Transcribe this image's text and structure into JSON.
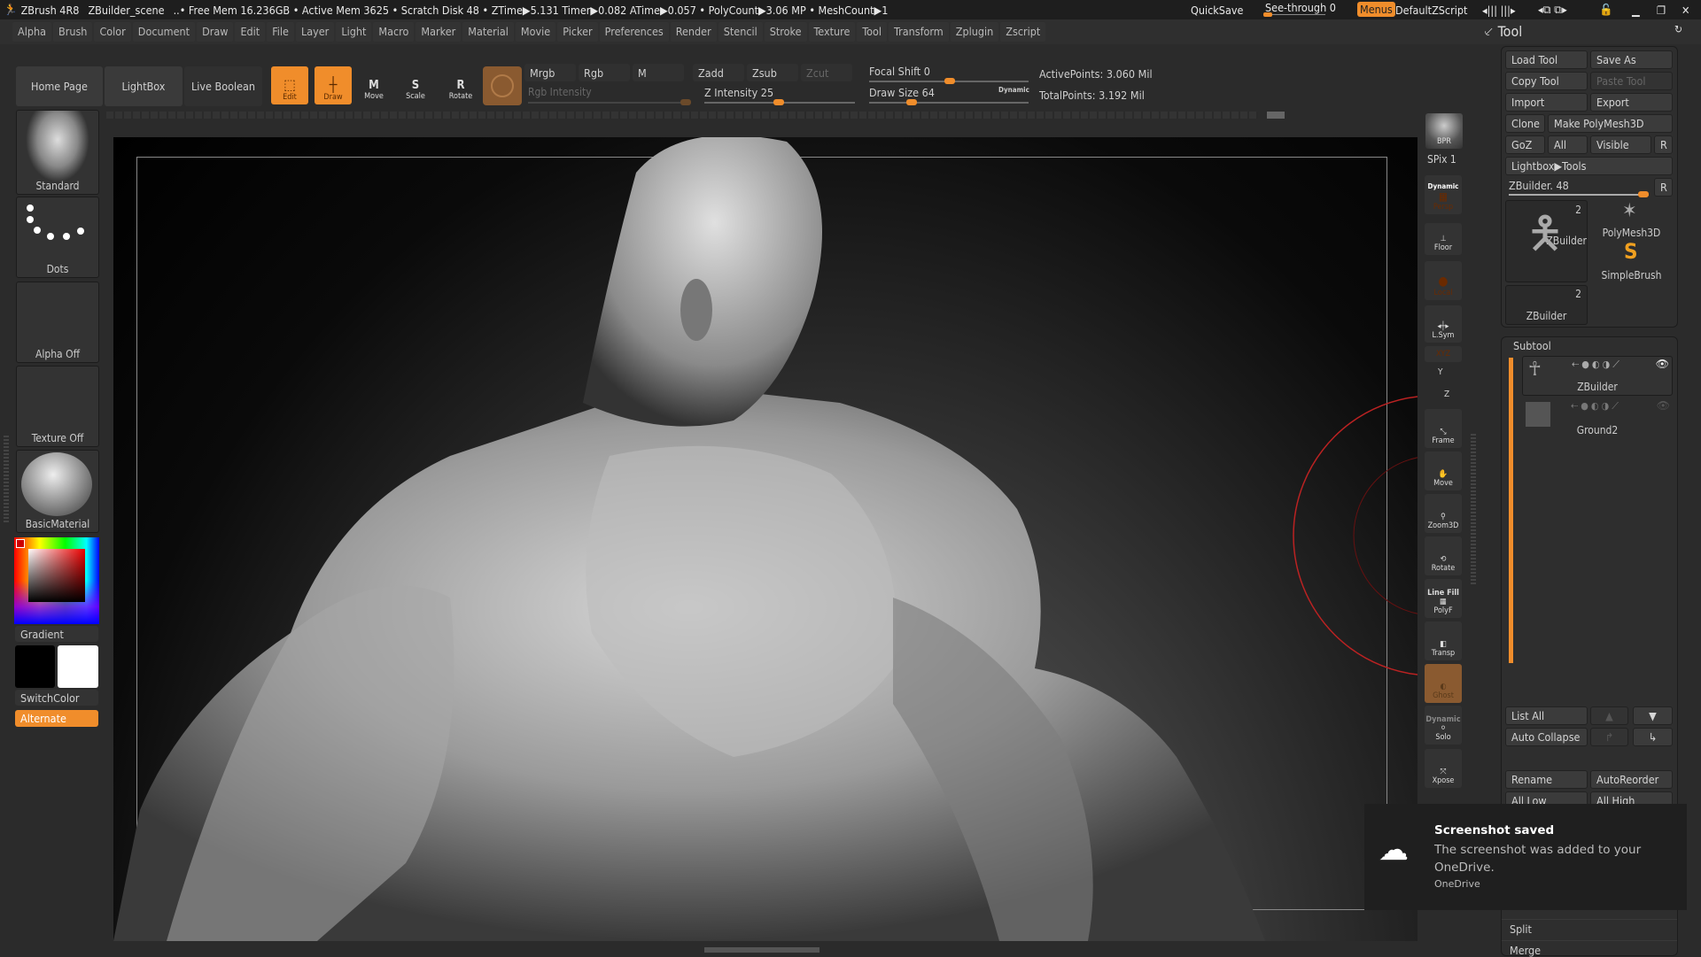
{
  "titlebar": {
    "app": "ZBrush 4R8",
    "scene": "ZBuilder_scene",
    "stats": "..• Free Mem 16.236GB • Active Mem 3625 • Scratch Disk 48 • ZTime▶5.131 Timer▶0.082 ATime▶0.057 • PolyCount▶3.06 MP • MeshCount▶1",
    "quicksave": "QuickSave",
    "seethrough": "See-through  0",
    "seethrough_value": 0,
    "menus": "Menus",
    "defaultzscript": "DefaultZScript"
  },
  "menus": [
    "Alpha",
    "Brush",
    "Color",
    "Document",
    "Draw",
    "Edit",
    "File",
    "Layer",
    "Light",
    "Macro",
    "Marker",
    "Material",
    "Movie",
    "Picker",
    "Preferences",
    "Render",
    "Stencil",
    "Stroke",
    "Texture",
    "Tool",
    "Transform",
    "Zplugin",
    "Zscript"
  ],
  "toolbar": {
    "home": "Home Page",
    "lightbox": "LightBox",
    "liveboolean": "Live Boolean",
    "edit": "Edit",
    "draw": "Draw",
    "move": "Move",
    "scale": "Scale",
    "rotate": "Rotate",
    "mrgb": "Mrgb",
    "rgb": "Rgb",
    "m": "M",
    "zadd": "Zadd",
    "zsub": "Zsub",
    "zcut": "Zcut",
    "rgb_intensity": "Rgb Intensity",
    "z_intensity": "Z Intensity 25",
    "z_intensity_value": 25,
    "focal_shift": "Focal Shift 0",
    "focal_shift_value": 0,
    "draw_size": "Draw Size 64",
    "draw_size_value": 64,
    "dynamic": "Dynamic",
    "active_points": "ActivePoints: 3.060 Mil",
    "total_points": "TotalPoints: 3.192 Mil"
  },
  "left": {
    "brush": "Standard",
    "stroke": "Dots",
    "alpha": "Alpha Off",
    "texture": "Texture Off",
    "material": "BasicMaterial",
    "gradient": "Gradient",
    "switchcolor": "SwitchColor",
    "alternate": "Alternate"
  },
  "shelf": {
    "bpr": "BPR",
    "spix": "SPix 1",
    "dynamic": "Dynamic",
    "persp": "Persp",
    "floor": "Floor",
    "local": "Local",
    "lsym": "L.Sym",
    "xyz": "XYZ",
    "y": "Y",
    "z": "Z",
    "frame": "Frame",
    "move": "Move",
    "zoom3d": "Zoom3D",
    "rotate": "Rotate",
    "linefill": "Line Fill",
    "polyf": "PolyF",
    "transp": "Transp",
    "ghost": "Ghost",
    "dynamic2": "Dynamic",
    "solo": "Solo",
    "xpose": "Xpose"
  },
  "tool": {
    "title": "Tool",
    "load": "Load Tool",
    "saveas": "Save As",
    "copy": "Copy Tool",
    "paste": "Paste Tool",
    "import": "Import",
    "export": "Export",
    "clone": "Clone",
    "makepoly": "Make PolyMesh3D",
    "goz": "GoZ",
    "all": "All",
    "visible": "Visible",
    "r": "R",
    "lightbox": "Lightbox▶Tools",
    "current": "ZBuilder. 48",
    "thumbs": [
      {
        "name": "ZBuilder",
        "count": "2"
      },
      {
        "name": "PolyMesh3D"
      },
      {
        "name": "SimpleBrush"
      },
      {
        "name": "ZBuilder",
        "count": "2"
      }
    ]
  },
  "subtool": {
    "title": "Subtool",
    "items": [
      "ZBuilder",
      "Ground2"
    ],
    "listall": "List All",
    "autocollapse": "Auto Collapse",
    "rename": "Rename",
    "autoreorder": "AutoReorder",
    "alllow": "All Low",
    "allhigh": "All High",
    "split": "Split",
    "merge": "Merge"
  },
  "toast": {
    "title": "Screenshot saved",
    "body": "The screenshot was added to your OneDrive.",
    "source": "OneDrive"
  }
}
